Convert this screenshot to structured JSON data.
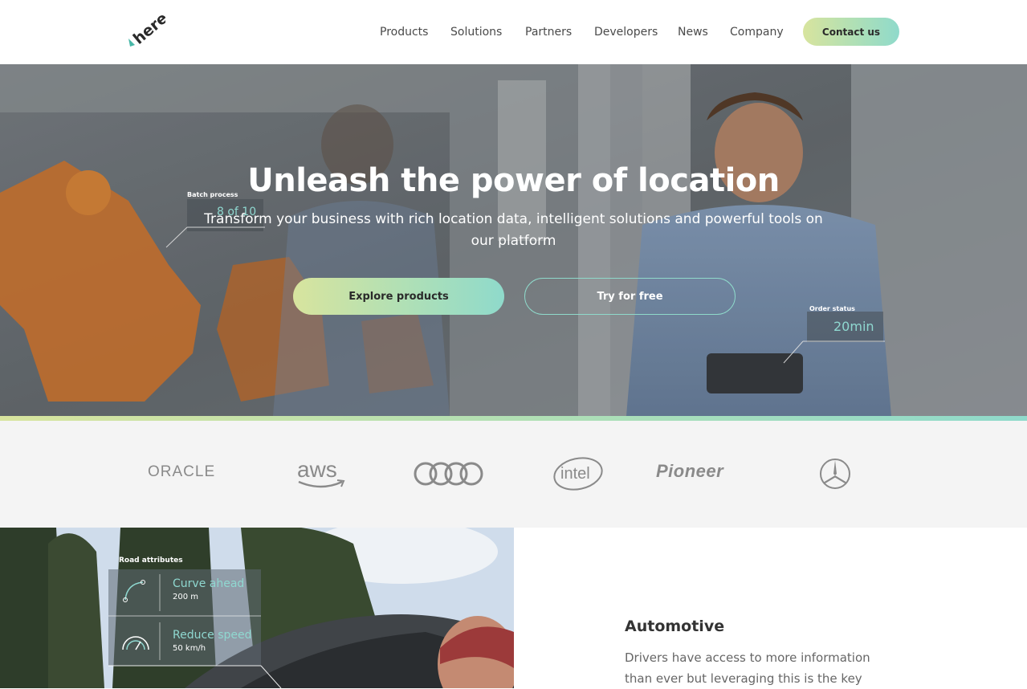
{
  "header": {
    "logo_text": "here",
    "nav": [
      "Products",
      "Solutions",
      "Partners",
      "Developers",
      "News",
      "Company"
    ],
    "contact_label": "Contact us"
  },
  "hero": {
    "title": "Unleash the power of location",
    "subtitle": "Transform your business with rich location data, intelligent solutions and powerful tools on our platform",
    "primary_button": "Explore products",
    "secondary_button": "Try for free",
    "overlay_left": {
      "label": "Batch process",
      "value": "8 of 10"
    },
    "overlay_right": {
      "label": "Order status",
      "value": "20min"
    }
  },
  "partners": {
    "logos": [
      "ORACLE",
      "aws",
      "audi-rings",
      "intel",
      "Pioneer",
      "mercedes-star"
    ]
  },
  "automotive": {
    "title": "Automotive",
    "text": "Drivers have access to more information than ever but leveraging this is the key",
    "overlay": {
      "heading": "Road attributes",
      "items": [
        {
          "title": "Curve ahead",
          "detail": "200 m",
          "icon": "curve-icon"
        },
        {
          "title": "Reduce speed",
          "detail": "50 km/h",
          "icon": "speedometer-icon"
        }
      ]
    }
  },
  "colors": {
    "accent_start": "#d8e49e",
    "accent_end": "#8fdacb",
    "logo_teal": "#48b8a8"
  }
}
